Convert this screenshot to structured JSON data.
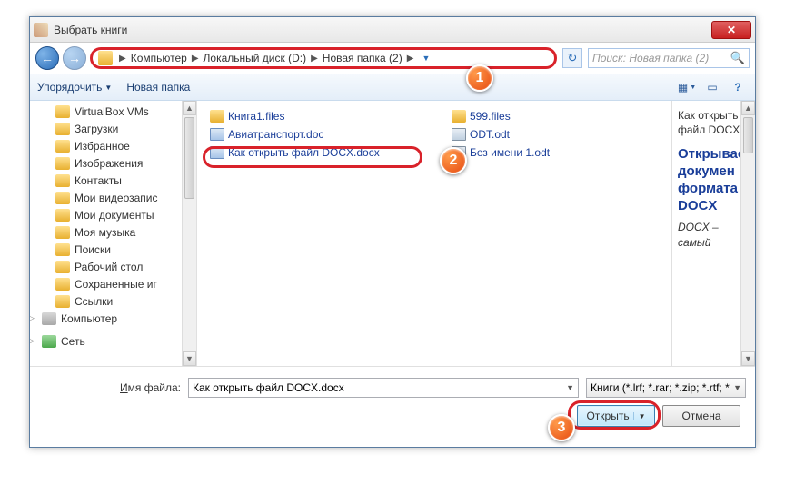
{
  "title": "Выбрать книги",
  "breadcrumb": {
    "seg1": "Компьютер",
    "seg2": "Локальный диск (D:)",
    "seg3": "Новая папка (2)"
  },
  "search_placeholder": "Поиск: Новая папка (2)",
  "toolbar": {
    "organize": "Упорядочить",
    "newfolder": "Новая папка"
  },
  "tree": [
    {
      "label": "VirtualBox VMs",
      "icon": "f"
    },
    {
      "label": "Загрузки",
      "icon": "f"
    },
    {
      "label": "Избранное",
      "icon": "f"
    },
    {
      "label": "Изображения",
      "icon": "f"
    },
    {
      "label": "Контакты",
      "icon": "f"
    },
    {
      "label": "Мои видеозапис",
      "icon": "f"
    },
    {
      "label": "Мои документы",
      "icon": "f"
    },
    {
      "label": "Моя музыка",
      "icon": "f"
    },
    {
      "label": "Поиски",
      "icon": "f"
    },
    {
      "label": "Рабочий стол",
      "icon": "f"
    },
    {
      "label": "Сохраненные иг",
      "icon": "f"
    },
    {
      "label": "Ссылки",
      "icon": "f"
    }
  ],
  "tree_root1": "Компьютер",
  "tree_root2": "Сеть",
  "files_col1": [
    {
      "name": "Книга1.files",
      "icon": "folder"
    },
    {
      "name": "Авиатранспорт.doc",
      "icon": "doc"
    },
    {
      "name": "Как открыть файл DOCX.docx",
      "icon": "doc",
      "selected": true
    }
  ],
  "files_col2": [
    {
      "name": "599.files",
      "icon": "folder"
    },
    {
      "name": "ODT.odt",
      "icon": "odt"
    },
    {
      "name": "Без имени 1.odt",
      "icon": "odt"
    }
  ],
  "preview": {
    "line1": "Как открыть файл DOCX",
    "heading": "Открывае докумен формата DOCX",
    "body": "DOCX – самый"
  },
  "footer": {
    "label": "Имя файла:",
    "label_u": "И",
    "value": "Как открыть файл DOCX.docx",
    "filter": "Книги (*.lrf; *.rar; *.zip; *.rtf; *.lit",
    "open": "Открыть",
    "cancel": "Отмена"
  },
  "badges": {
    "b1": "1",
    "b2": "2",
    "b3": "3"
  }
}
